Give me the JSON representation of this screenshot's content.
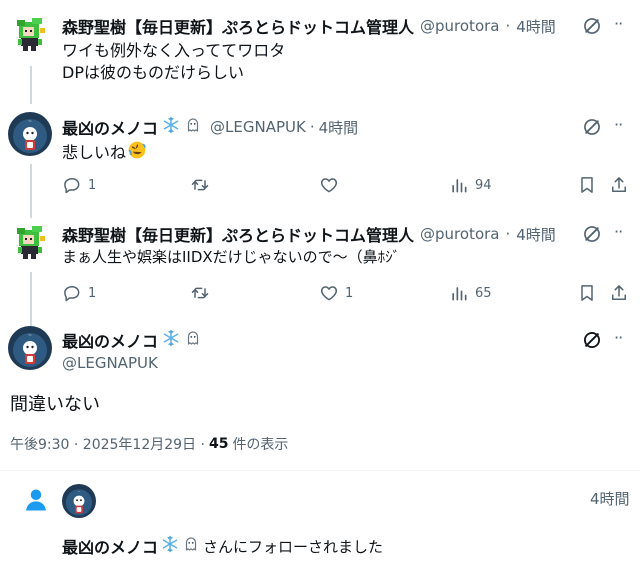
{
  "colors": {
    "text": "#0f1419",
    "muted": "#536471",
    "blue": "#1d9bf0",
    "line": "#cfd9de",
    "divider": "#eff3f4"
  },
  "tweet1": {
    "name": "森野聖樹【毎日更新】ぷろとらドットコム管理人",
    "handle": "@purotora",
    "time": "4時間",
    "line1": "ワイも例外なく入っててワロタ",
    "line2": "DPは彼のものだけらしい"
  },
  "tweet2": {
    "name": "最凶のメノコ",
    "handle": "@LEGNAPUK",
    "time": "4時間",
    "text": "悲しいね",
    "replies": "1",
    "likes": "",
    "views": "94"
  },
  "tweet3": {
    "name": "森野聖樹【毎日更新】ぷろとらドットコム管理人",
    "handle": "@purotora",
    "time": "4時間",
    "text": "まぁ人生や娯楽はIIDXだけじゃないので〜（鼻ﾎｼﾞ",
    "replies": "1",
    "likes": "1",
    "views": "65"
  },
  "main": {
    "name": "最凶のメノコ",
    "handle": "@LEGNAPUK",
    "text": "間違いない",
    "datetime": "午後9:30 · 2025年12月29日 ·",
    "views_count": "45",
    "views_label": "件の表示"
  },
  "notification": {
    "time": "4時間",
    "name": "最凶のメノコ",
    "text": "さんにフォローされました"
  },
  "separator": "·",
  "icons": [
    "grok-icon",
    "reply-icon",
    "retweet-icon",
    "like-icon",
    "views-icon",
    "bookmark-icon",
    "share-icon",
    "snowflake-emoji",
    "ghost-emoji",
    "rofl-emoji",
    "person-icon"
  ]
}
